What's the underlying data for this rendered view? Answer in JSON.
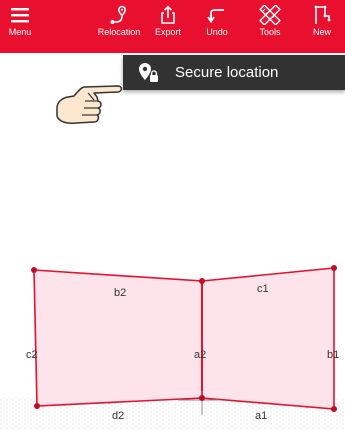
{
  "toolbar": {
    "background": "#e8102e",
    "items": [
      {
        "label": "Menu",
        "icon": "hamburger-menu-icon"
      },
      {
        "label": "Relocation",
        "icon": "relocation-pin-path-icon"
      },
      {
        "label": "Export",
        "icon": "export-share-icon"
      },
      {
        "label": "Undo",
        "icon": "undo-arrow-icon"
      },
      {
        "label": "Tools",
        "icon": "ruler-pencil-tools-icon"
      },
      {
        "label": "New",
        "icon": "new-drawing-icon"
      }
    ]
  },
  "popup": {
    "label": "Secure location",
    "icon": "location-pin-lock-icon",
    "background": "#323232"
  },
  "hint": {
    "icon": "pointing-hand-icon"
  },
  "drawing": {
    "fill": "#fce4ea",
    "stroke": "#e8102e",
    "labels": {
      "b2": "b2",
      "c1": "c1",
      "c2": "c2",
      "a2": "a2",
      "b1": "b1",
      "d2": "d2",
      "a1": "a1"
    }
  }
}
